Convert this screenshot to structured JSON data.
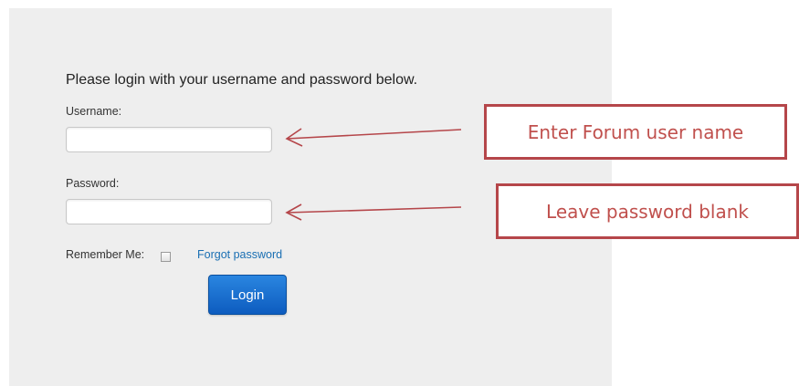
{
  "login_form": {
    "intro": "Please login with your username and password below.",
    "username_label": "Username:",
    "username_value": "",
    "password_label": "Password:",
    "password_value": "",
    "remember_label": "Remember Me:",
    "remember_checked": false,
    "forgot_password_link": "Forgot password",
    "login_button": "Login"
  },
  "annotations": {
    "username_callout": "Enter Forum user name",
    "password_callout": "Leave password blank"
  },
  "colors": {
    "panel_background": "#eeeeee",
    "link": "#1a6fb3",
    "button": "#0d5cbf",
    "annotation": "#c0504d"
  },
  "icons": {
    "arrow": "left-arrow-icon"
  }
}
